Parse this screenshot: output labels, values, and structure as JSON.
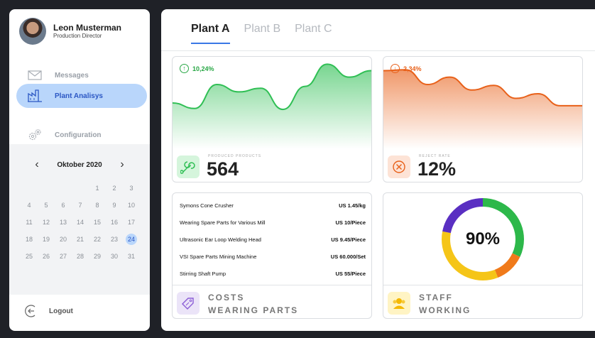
{
  "profile": {
    "name": "Leon Musterman",
    "role": "Production Director"
  },
  "nav": {
    "messages": "Messages",
    "plant": "Plant Analisys",
    "configuration": "Configuration",
    "logout": "Logout"
  },
  "calendar": {
    "month": "Oktober 2020",
    "prev": "‹",
    "next": "›",
    "weeks": [
      [
        "",
        "",
        "",
        "",
        "1",
        "2",
        "3"
      ],
      [
        "4",
        "5",
        "6",
        "7",
        "8",
        "9",
        "10"
      ],
      [
        "11",
        "12",
        "13",
        "14",
        "15",
        "16",
        "17"
      ],
      [
        "18",
        "19",
        "20",
        "21",
        "22",
        "23",
        "24"
      ],
      [
        "25",
        "26",
        "27",
        "28",
        "29",
        "30",
        "31"
      ]
    ],
    "selected": "24"
  },
  "tabs": [
    "Plant A",
    "Plant B",
    "Plant C"
  ],
  "produced": {
    "change": "10,24%",
    "caption": "PRODUCED PRODUCTS",
    "value": "564",
    "color": "#2fbf54",
    "trend": [
      5.0,
      4.4,
      7.0,
      6.2,
      6.6,
      4.3,
      6.8,
      9.2,
      7.8,
      8.5
    ]
  },
  "reject": {
    "change": "2,34%",
    "caption": "REJECT RATE",
    "value": "12%",
    "color": "#e8611a",
    "trend": [
      8.5,
      8.6,
      7.0,
      7.8,
      6.4,
      6.9,
      5.5,
      6.0,
      4.7,
      4.7
    ]
  },
  "costs": {
    "items": [
      {
        "name": "Symons Cone Crusher",
        "price": "US 1.45/kg"
      },
      {
        "name": "Wearing Spare Parts for Various Mill",
        "price": "US 10/Piece"
      },
      {
        "name": "Ultrasonic Ear Loop Welding Head",
        "price": "US 9.45/Piece"
      },
      {
        "name": "VSI Spare Parts Mining  Machine",
        "price": "US 60.000/Set"
      },
      {
        "name": "Stirring Shaft Pump",
        "price": "US 55/Piece"
      }
    ],
    "label_line1": "COSTS",
    "label_line2": "WEARING PARTS"
  },
  "staff": {
    "value": "90%",
    "label_line1": "STAFF",
    "label_line2": "WORKING",
    "segments": [
      {
        "color": "#2db84a",
        "fraction": 0.32
      },
      {
        "color": "#f07a1a",
        "fraction": 0.12
      },
      {
        "color": "#f5c518",
        "fraction": 0.34
      },
      {
        "color": "#5a2fc2",
        "fraction": 0.22
      }
    ]
  }
}
